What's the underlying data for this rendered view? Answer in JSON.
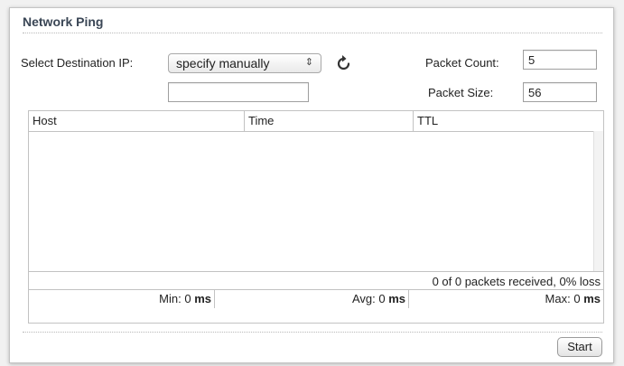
{
  "panel": {
    "title": "Network Ping"
  },
  "form": {
    "destination_label": "Select Destination IP:",
    "destination_select_value": "specify manually",
    "destination_select_arrows": "⇕",
    "manual_ip_value": "",
    "packet_count_label": "Packet Count:",
    "packet_count_value": "5",
    "packet_size_label": "Packet Size:",
    "packet_size_value": "56",
    "refresh_icon": "refresh-icon"
  },
  "table": {
    "columns": [
      "Host",
      "Time",
      "TTL"
    ],
    "rows": [],
    "summary": "0 of 0 packets received, 0% loss",
    "stats": {
      "min_label": "Min:",
      "min_value": "0",
      "avg_label": "Avg:",
      "avg_value": "0",
      "max_label": "Max:",
      "max_value": "0",
      "unit": "ms"
    }
  },
  "actions": {
    "start_label": "Start"
  }
}
